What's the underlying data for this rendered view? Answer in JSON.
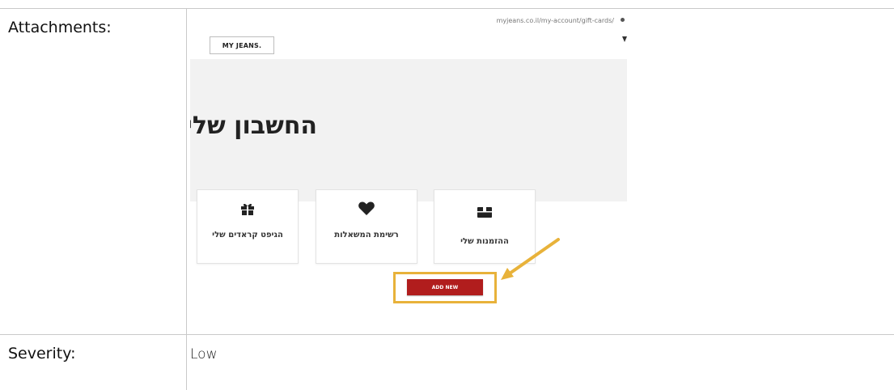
{
  "rows": [
    {
      "label": "Attachments:"
    },
    {
      "label": "Severity:",
      "value": "Low"
    }
  ],
  "attachment": {
    "url": "myjeans.co.il/my-account/gift-cards/",
    "logo_text": "MY JEANS.",
    "account_title": "החשבון שלי",
    "cards": [
      {
        "icon": "gift-icon",
        "glyph": "🎁",
        "label": "הגיפט קראדים שלי"
      },
      {
        "icon": "heart-icon",
        "glyph": "❤",
        "label": "רשימת המשאלות"
      },
      {
        "icon": "box-icon",
        "glyph": "▬",
        "label": "ההזמנות שלי"
      }
    ],
    "add_button_label": "ADD NEW",
    "highlight_color": "#e8b23a",
    "button_color": "#b11d1d"
  }
}
